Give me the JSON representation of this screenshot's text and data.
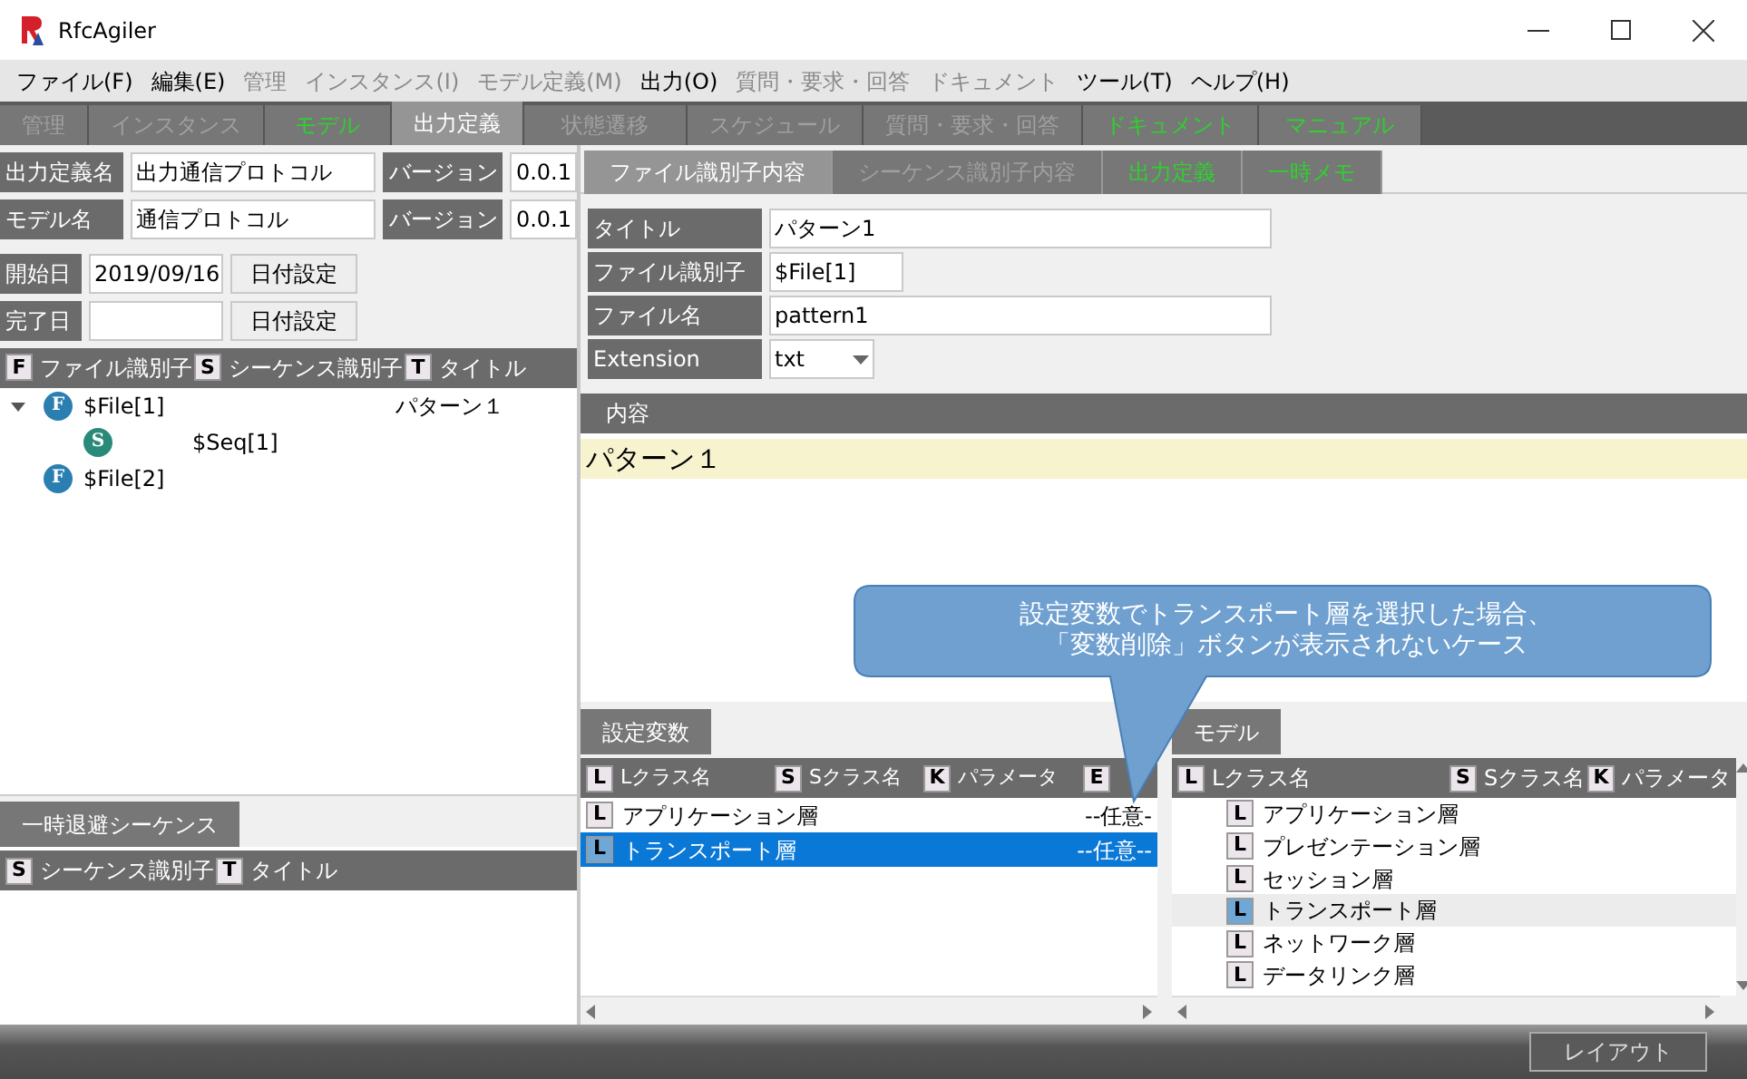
{
  "window": {
    "title": "RfcAgiler"
  },
  "menu": [
    {
      "label": "ファイル(F)",
      "disabled": false
    },
    {
      "label": "編集(E)",
      "disabled": false
    },
    {
      "label": "管理",
      "disabled": true
    },
    {
      "label": "インスタンス(I)",
      "disabled": true
    },
    {
      "label": "モデル定義(M)",
      "disabled": true
    },
    {
      "label": "出力(O)",
      "disabled": false
    },
    {
      "label": "質問・要求・回答",
      "disabled": true
    },
    {
      "label": "ドキュメント",
      "disabled": true
    },
    {
      "label": "ツール(T)",
      "disabled": false
    },
    {
      "label": "ヘルプ(H)",
      "disabled": false
    }
  ],
  "tabs": [
    {
      "label": "管理",
      "selected": false,
      "disabled": true,
      "highlighted": false
    },
    {
      "label": "インスタンス",
      "selected": false,
      "disabled": true,
      "highlighted": false
    },
    {
      "label": "モデル",
      "selected": false,
      "disabled": false,
      "highlighted": true
    },
    {
      "label": "出力定義",
      "selected": true,
      "disabled": false,
      "highlighted": false
    },
    {
      "label": "状態遷移",
      "selected": false,
      "disabled": true,
      "highlighted": false
    },
    {
      "label": "スケジュール",
      "selected": false,
      "disabled": true,
      "highlighted": false
    },
    {
      "label": "質問・要求・回答",
      "selected": false,
      "disabled": true,
      "highlighted": false
    },
    {
      "label": "ドキュメント",
      "selected": false,
      "disabled": false,
      "highlighted": true
    },
    {
      "label": "マニュアル",
      "selected": false,
      "disabled": false,
      "highlighted": true
    }
  ],
  "definition": {
    "rows": [
      {
        "label": "出力定義名",
        "value": "出力通信プロトコル",
        "version_label": "バージョン",
        "version": "0.0.1"
      },
      {
        "label": "モデル名",
        "value": "通信プロトコル",
        "version_label": "バージョン",
        "version": "0.0.1"
      }
    ],
    "dates": [
      {
        "label": "開始日",
        "value": "2019/09/16",
        "button": "日付設定"
      },
      {
        "label": "完了日",
        "button": "日付設定"
      }
    ]
  },
  "tree": {
    "columns": [
      {
        "icon": "F",
        "label": "ファイル識別子"
      },
      {
        "icon": "S",
        "label": "シーケンス識別子"
      },
      {
        "icon": "T",
        "label": "タイトル"
      }
    ],
    "items": [
      {
        "kind": "file",
        "icon": "F",
        "id": "$File[1]",
        "title": "パターン１",
        "expanded": true,
        "children": [
          {
            "kind": "sequence",
            "icon": "S",
            "id": "$Seq[1]"
          }
        ]
      },
      {
        "kind": "file",
        "icon": "F",
        "id": "$File[2]"
      }
    ]
  },
  "temp": {
    "tab": "一時退避シーケンス",
    "columns": [
      {
        "icon": "S",
        "label": "シーケンス識別子"
      },
      {
        "icon": "T",
        "label": "タイトル"
      }
    ]
  },
  "detail_tabs": [
    {
      "label": "ファイル識別子内容",
      "selected": true,
      "disabled": false,
      "highlighted": false
    },
    {
      "label": "シーケンス識別子内容",
      "selected": false,
      "disabled": true,
      "highlighted": false
    },
    {
      "label": "出力定義",
      "selected": false,
      "disabled": false,
      "highlighted": true
    },
    {
      "label": "一時メモ",
      "selected": false,
      "disabled": false,
      "highlighted": true
    }
  ],
  "detail_form": [
    {
      "kind": "text",
      "label": "タイトル",
      "value": "パターン1"
    },
    {
      "kind": "short",
      "label": "ファイル識別子",
      "value": "$File[1]"
    },
    {
      "kind": "text",
      "label": "ファイル名",
      "value": "pattern1"
    },
    {
      "kind": "select",
      "label": "Extension",
      "value": "txt"
    }
  ],
  "content": {
    "header": "内容",
    "text": "パターン１"
  },
  "callout": {
    "lines": [
      "設定変数でトランスポート層を選択した場合、",
      "「変数削除」ボタンが表示されないケース"
    ]
  },
  "variables": {
    "tab": "設定変数",
    "columns": [
      {
        "icon": "L",
        "label": "Lクラス名"
      },
      {
        "icon": "S",
        "label": "Sクラス名"
      },
      {
        "icon": "K",
        "label": "パラメータ"
      },
      {
        "icon": "E"
      }
    ],
    "rows": [
      {
        "icon": "L",
        "name": "アプリケーション層",
        "value": "--任意-",
        "selected": false
      },
      {
        "icon": "L",
        "name": "トランスポート層",
        "value": "--任意--",
        "selected": true
      }
    ]
  },
  "model": {
    "tab": "モデル",
    "columns": [
      {
        "icon": "L",
        "label": "Lクラス名"
      },
      {
        "icon": "S",
        "label": "Sクラス名"
      },
      {
        "icon": "K",
        "label": "パラメータ"
      }
    ],
    "rows": [
      {
        "icon": "L",
        "name": "アプリケーション層",
        "selected": false
      },
      {
        "icon": "L",
        "name": "プレゼンテーション層",
        "selected": false
      },
      {
        "icon": "L",
        "name": "セッション層",
        "selected": false
      },
      {
        "icon": "L",
        "name": "トランスポート層",
        "selected": true
      },
      {
        "icon": "L",
        "name": "ネットワーク層",
        "selected": false
      },
      {
        "icon": "L",
        "name": "データリンク層",
        "selected": false
      }
    ]
  },
  "status_bar": {
    "button": "レイアウト"
  }
}
